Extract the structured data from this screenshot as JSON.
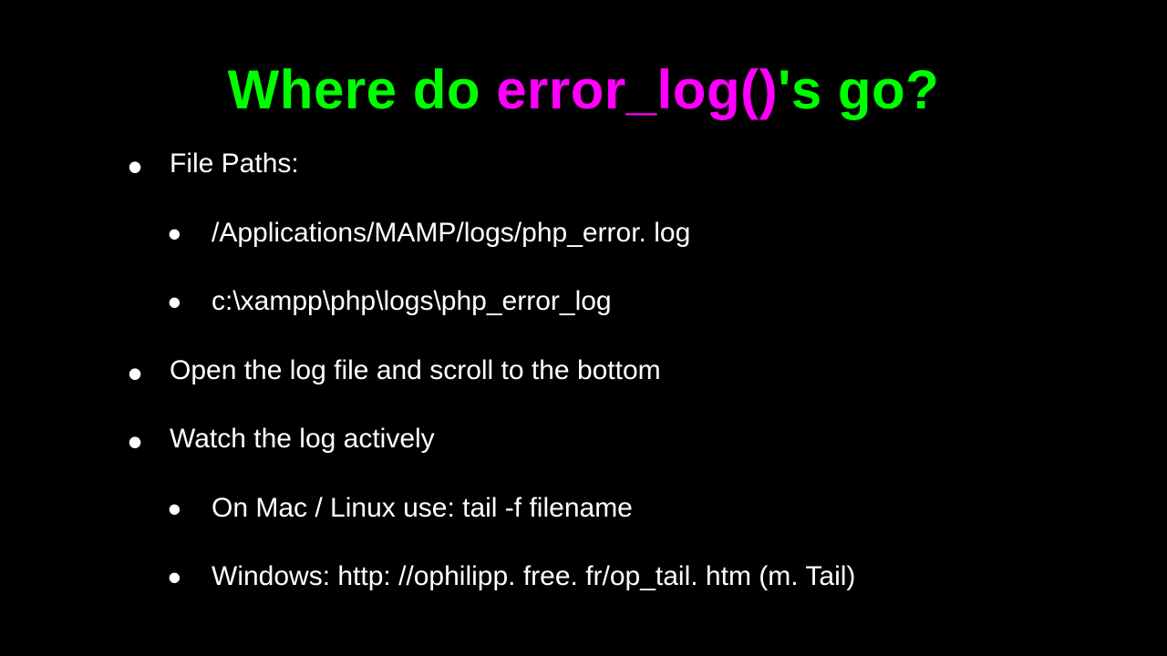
{
  "title": {
    "part1": "Where do ",
    "part2": "error_log()",
    "part3": "'s go?"
  },
  "bullets": {
    "l1": "File Paths:",
    "l1a": "/Applications/MAMP/logs/php_error. log",
    "l1b": "c:\\xampp\\php\\logs\\php_error_log",
    "l2": "Open the log file and scroll to the bottom",
    "l3": "Watch the log actively",
    "l3a": "On Mac / Linux use:   tail -f filename",
    "l3b": "Windows: http: //ophilipp. free. fr/op_tail. htm  (m. Tail)"
  }
}
